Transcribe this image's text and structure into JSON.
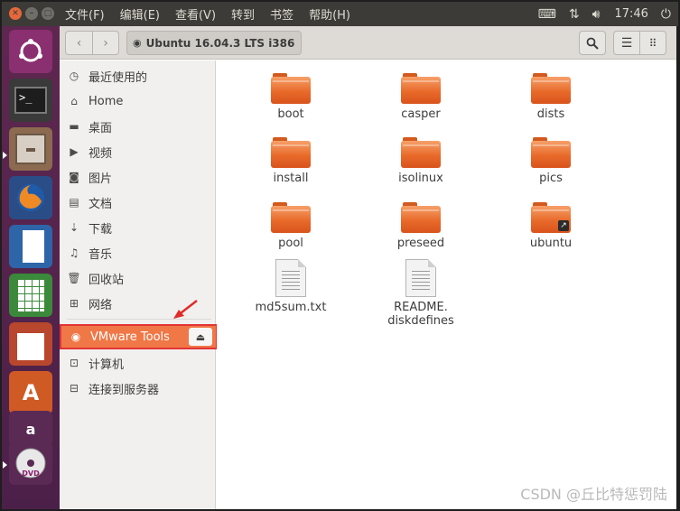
{
  "top_panel": {
    "menu": [
      "文件(F)",
      "编辑(E)",
      "查看(V)",
      "转到",
      "书签",
      "帮助(H)"
    ],
    "clock": "17:46",
    "tray_icons": [
      "keyboard-icon",
      "network-icon",
      "volume-icon",
      "power-icon"
    ]
  },
  "toolbar": {
    "path_label": "Ubuntu 16.04.3 LTS i386"
  },
  "sidebar": {
    "items": [
      {
        "label": "最近使用的",
        "icon": "clock-icon"
      },
      {
        "label": "Home",
        "icon": "home-icon"
      },
      {
        "label": "桌面",
        "icon": "desktop-icon"
      },
      {
        "label": "视频",
        "icon": "video-icon"
      },
      {
        "label": "图片",
        "icon": "camera-icon"
      },
      {
        "label": "文档",
        "icon": "document-icon"
      },
      {
        "label": "下载",
        "icon": "download-icon"
      },
      {
        "label": "音乐",
        "icon": "music-icon"
      },
      {
        "label": "回收站",
        "icon": "trash-icon"
      },
      {
        "label": "网络",
        "icon": "network-icon"
      },
      {
        "label": "VMware Tools",
        "icon": "disc-icon",
        "selected": true
      },
      {
        "label": "计算机",
        "icon": "computer-icon"
      },
      {
        "label": "连接到服务器",
        "icon": "server-icon"
      }
    ]
  },
  "files": [
    {
      "name": "boot",
      "type": "folder"
    },
    {
      "name": "casper",
      "type": "folder"
    },
    {
      "name": "dists",
      "type": "folder"
    },
    {
      "name": "install",
      "type": "folder"
    },
    {
      "name": "isolinux",
      "type": "folder"
    },
    {
      "name": "pics",
      "type": "folder"
    },
    {
      "name": "pool",
      "type": "folder"
    },
    {
      "name": "preseed",
      "type": "folder"
    },
    {
      "name": "ubuntu",
      "type": "folder-link"
    },
    {
      "name": "md5sum.txt",
      "type": "text"
    },
    {
      "name": "README.",
      "name_line2": "diskdefines",
      "type": "text"
    }
  ],
  "colors": {
    "accent": "#f07746",
    "panel": "#3c3b37",
    "launcher": "#5e2750",
    "highlight_border": "#e33434"
  },
  "watermark": "CSDN @丘比特惩罚陆"
}
